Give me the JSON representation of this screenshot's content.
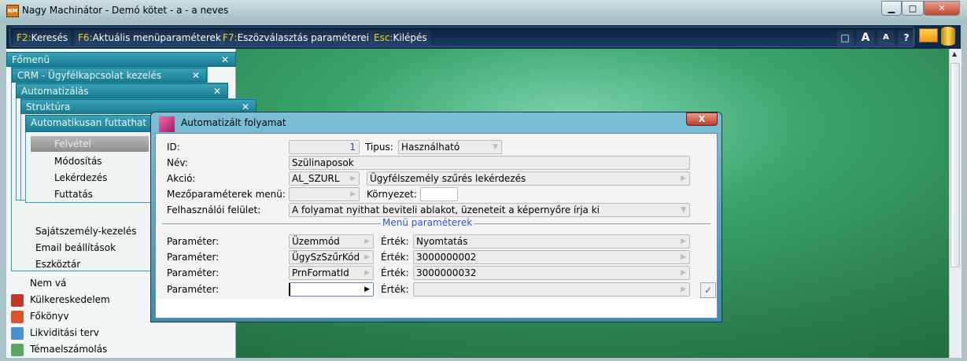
{
  "window": {
    "title": "Nagy Machinátor - Demó kötet - a - a neves",
    "minimize": "▁",
    "maximize": "□",
    "close": "✕",
    "logo": "NM"
  },
  "toolbar": {
    "items": [
      {
        "key": "F2:",
        "label": "Keresés"
      },
      {
        "key": "F6:",
        "label": "Aktuális menüparaméterek"
      },
      {
        "key": "F7:",
        "label": "Eszözválasztás paraméterei"
      },
      {
        "key": "Esc:",
        "label": "Kilépés"
      }
    ],
    "buttons": {
      "window": "□",
      "font_large": "A",
      "font_small": "A",
      "help": "?"
    },
    "icons": [
      "monitor-icon",
      "database-icon"
    ]
  },
  "menus": {
    "fomenu": "Főmenü",
    "crm": "CRM - Ügyfélkapcsolat kezelés",
    "automatizalas": "Automatizálás",
    "struktura": "Struktúra",
    "automatikusan": "Automatikusan futtathat",
    "close": "✕",
    "submenu": [
      "Felvétel",
      "Módosítás",
      "Lekérdezés",
      "Futtatás"
    ],
    "crm_items": [
      "Sajátszemély-kezelés",
      "Email beállítások",
      "Eszköztár"
    ],
    "main_items": [
      "Nem vá",
      "Külkereskedelem",
      "Főkönyv",
      "Likviditási terv",
      "Témaelszámolás"
    ]
  },
  "dialog": {
    "title": "Automatizált folyamat",
    "close": "X",
    "id_label": "ID:",
    "id_value": "1",
    "tipus_label": "Tipus:",
    "tipus_value": "Használható",
    "nev_label": "Név:",
    "nev_value": "Szülinaposok",
    "akcio_label": "Akció:",
    "akcio_code": "AL_SZURL",
    "akcio_name": "Ügyfélszemély szűrés lekérdezés",
    "mezo_label": "Mezőparaméterek menü:",
    "mezo_value": "",
    "kornyezet_label": "Környezet:",
    "kornyezet_value": "",
    "felulet_label": "Felhasználói felület:",
    "felulet_value": "A folyamat nyithat beviteli ablakot, üzeneteit a képernyőre írja ki",
    "section_title": "Menü paraméterek",
    "params": [
      {
        "label": "Paraméter:",
        "name": "Üzemmód",
        "value_label": "Érték:",
        "value": "Nyomtatás"
      },
      {
        "label": "Paraméter:",
        "name": "ÜgySzSzűrKód",
        "value_label": "Érték:",
        "value": "3000000002"
      },
      {
        "label": "Paraméter:",
        "name": "PrnFormatId",
        "value_label": "Érték:",
        "value": "3000000032"
      },
      {
        "label": "Paraméter:",
        "name": "",
        "value_label": "Érték:",
        "value": ""
      }
    ],
    "ok": "✓"
  }
}
